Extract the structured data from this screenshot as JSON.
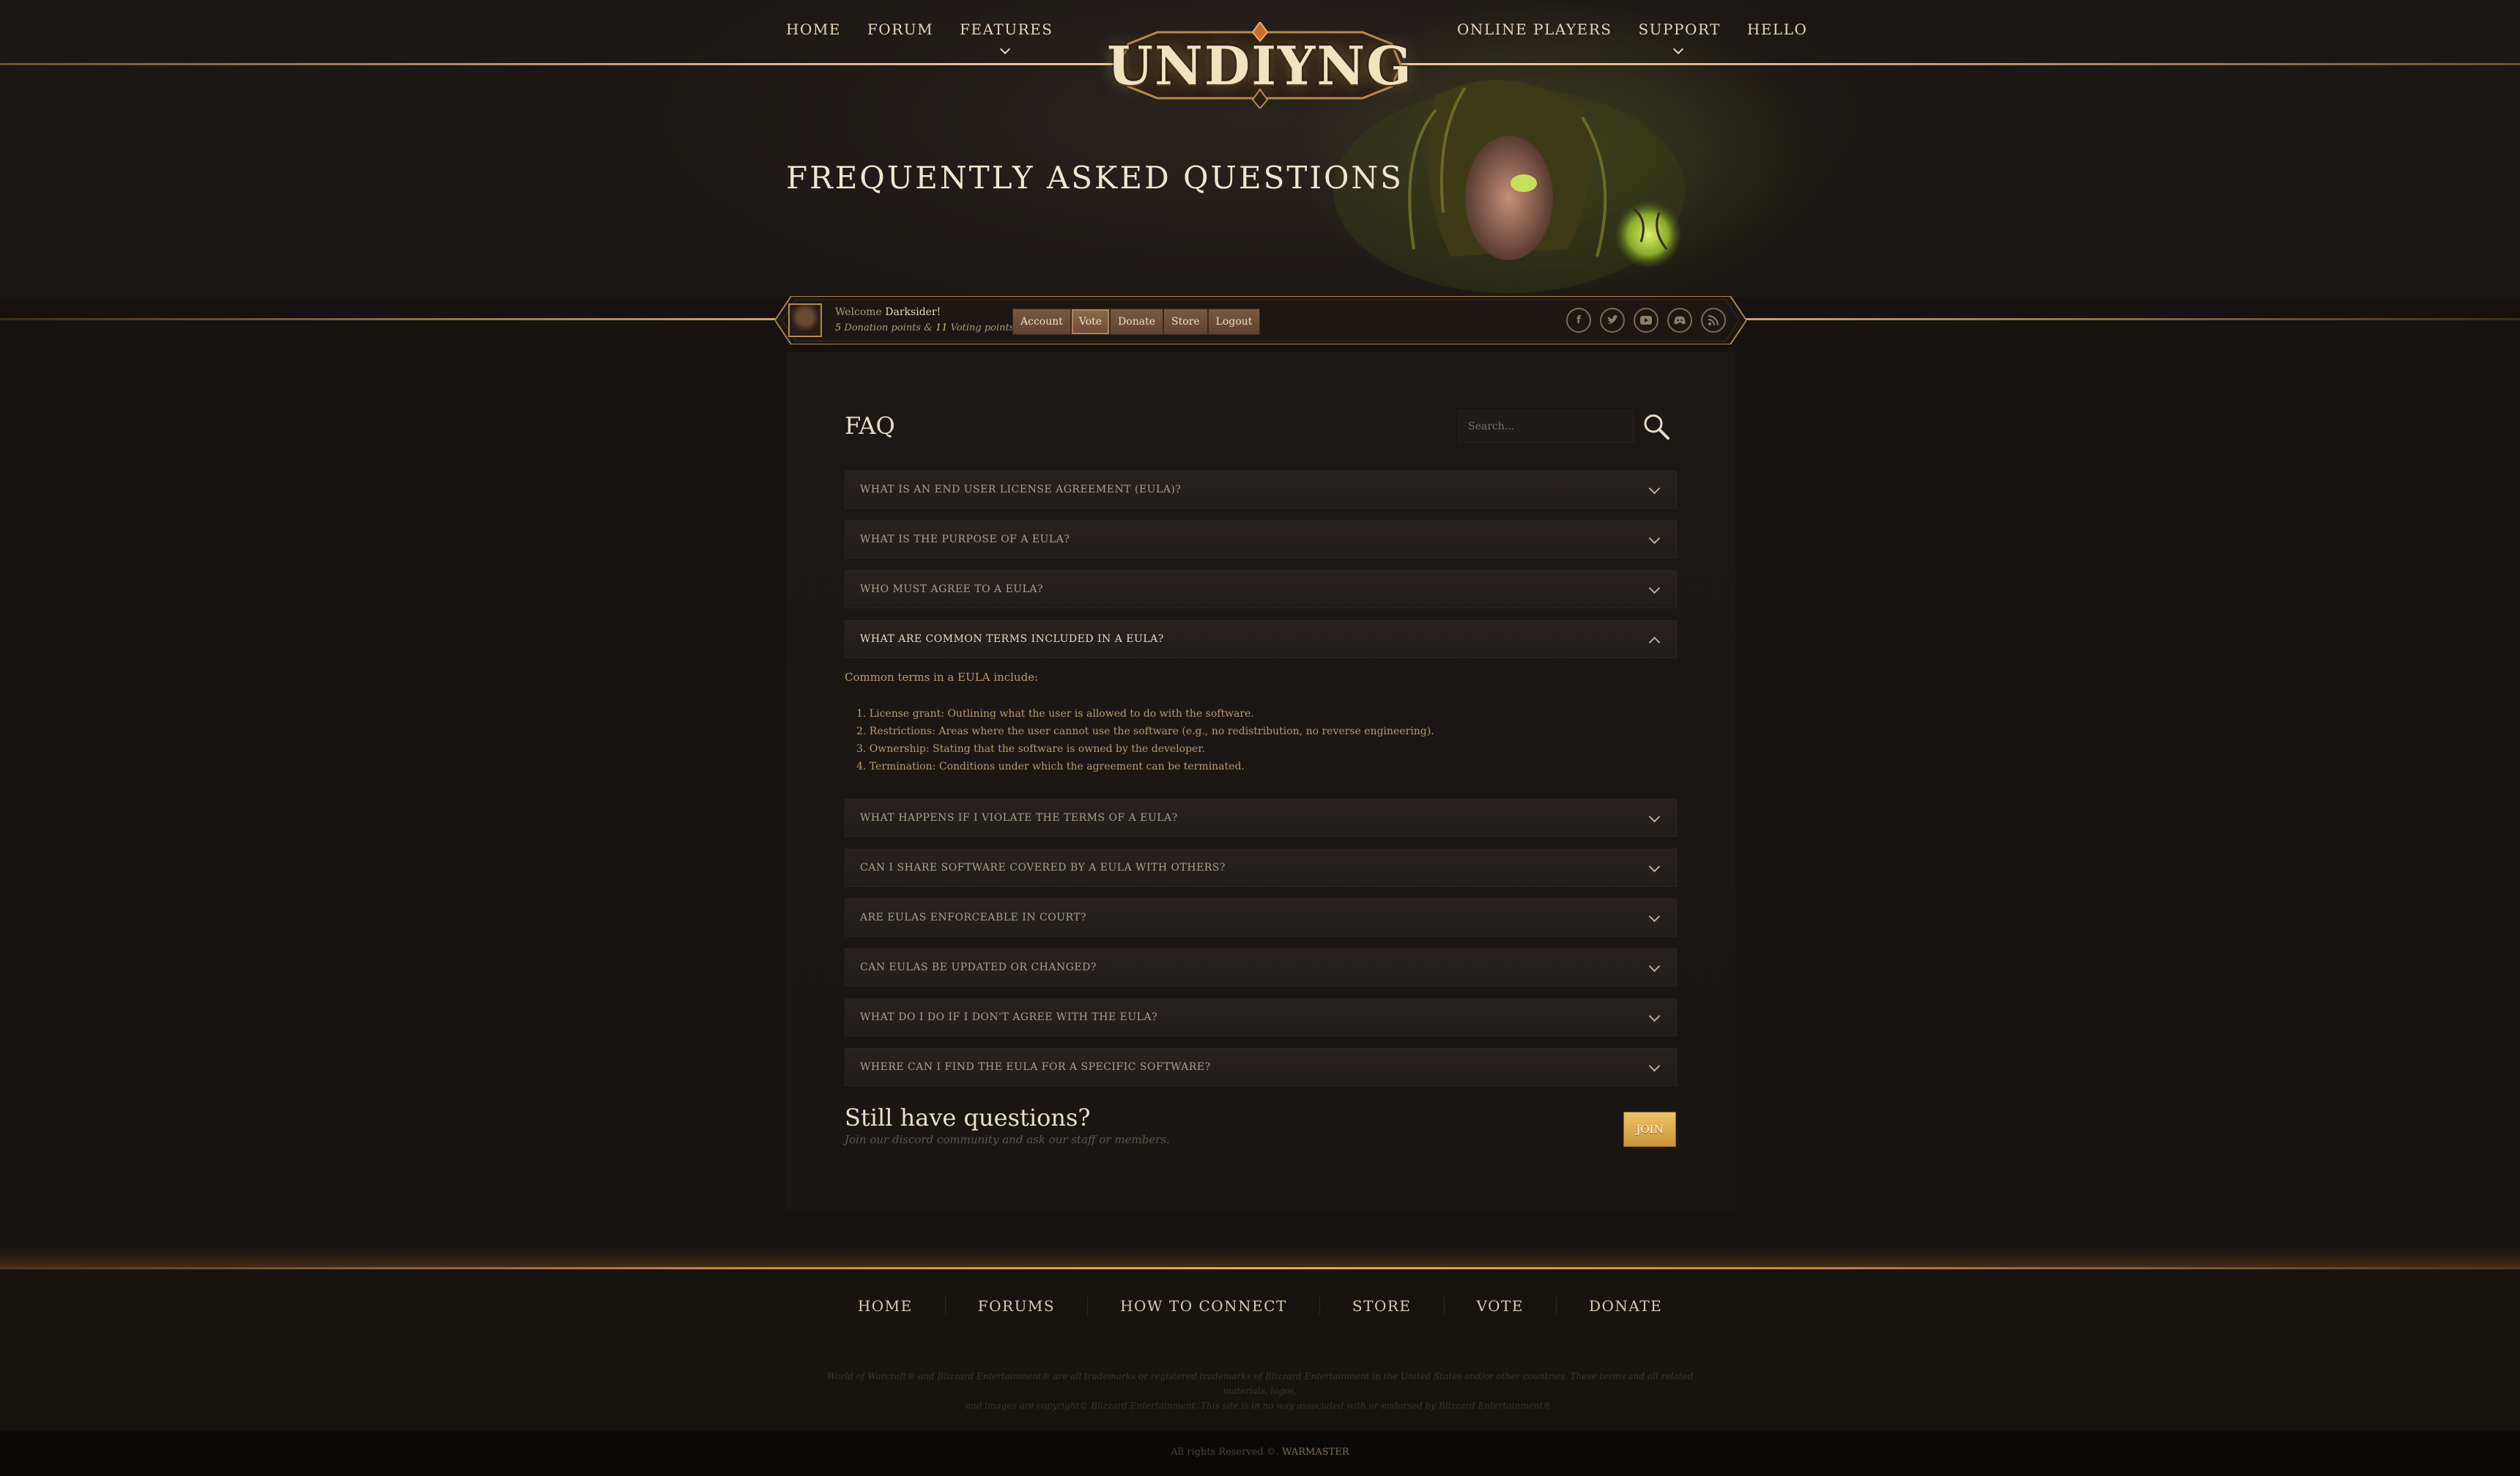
{
  "nav_left": [
    "Home",
    "Forum",
    "Features"
  ],
  "nav_right": [
    "Online Players",
    "Support",
    "Hello"
  ],
  "logo": "UNDIYNG",
  "hero": {
    "title": "Frequently Asked Questions"
  },
  "userbar": {
    "welcome_prefix": "Welcome",
    "username": "Darksider!",
    "donation_points": "5",
    "donation_label": "Donation points &",
    "voting_points": "11",
    "voting_label": "Voting points",
    "buttons": [
      "Account",
      "Vote",
      "Donate",
      "Store",
      "Logout"
    ],
    "active_button": "Vote",
    "socials": [
      "facebook-icon",
      "twitter-icon",
      "youtube-icon",
      "discord-icon",
      "rss-icon"
    ]
  },
  "faq": {
    "heading": "FAQ",
    "search_placeholder": "Search...",
    "questions": [
      "What is an End User License Agreement (EULA)?",
      "What is the purpose of a EULA?",
      "Who must agree to a EULA?",
      "What are common terms included in a EULA?",
      "What happens if I violate the terms of a EULA?",
      "Can I share software covered by a EULA with others?",
      "Are EULAs enforceable in court?",
      "Can EULAs be updated or changed?",
      "What do I do if I don't agree with the EULA?",
      "Where can I find the EULA for a specific software?"
    ],
    "open_index": 3,
    "answer_intro": "Common terms in a EULA include:",
    "answer_items": [
      "1. License grant: Outlining what the user is allowed to do with the software.",
      "2. Restrictions: Areas where the user cannot use the software (e.g., no redistribution, no reverse engineering).",
      "3. Ownership: Stating that the software is owned by the developer.",
      "4. Termination: Conditions under which the agreement can be terminated."
    ]
  },
  "cta": {
    "title": "Still have questions?",
    "subtitle": "Join our discord community and ask our staff or members.",
    "button": "JOIN"
  },
  "footer": {
    "nav": [
      "Home",
      "Forums",
      "How to Connect",
      "Store",
      "Vote",
      "Donate"
    ],
    "disclaimer_line1": "World of Warcraft® and Blizzard Entertainment® are all trademarks or registered trademarks of Blizzard Entertainment in the United States and/or other countries. These terms and all related materials, logos,",
    "disclaimer_line2": "and images are copyright© Blizzard Entertainment. This site is in no way associated with or endorsed by Blizzard Entertainment®.",
    "copyright_prefix": "All rights Reserved ©.",
    "copyright_brand": "WARMASTER"
  },
  "colors": {
    "accent_gold": "#d9b679",
    "join_button": "#e0ae52",
    "background": "#151210"
  }
}
